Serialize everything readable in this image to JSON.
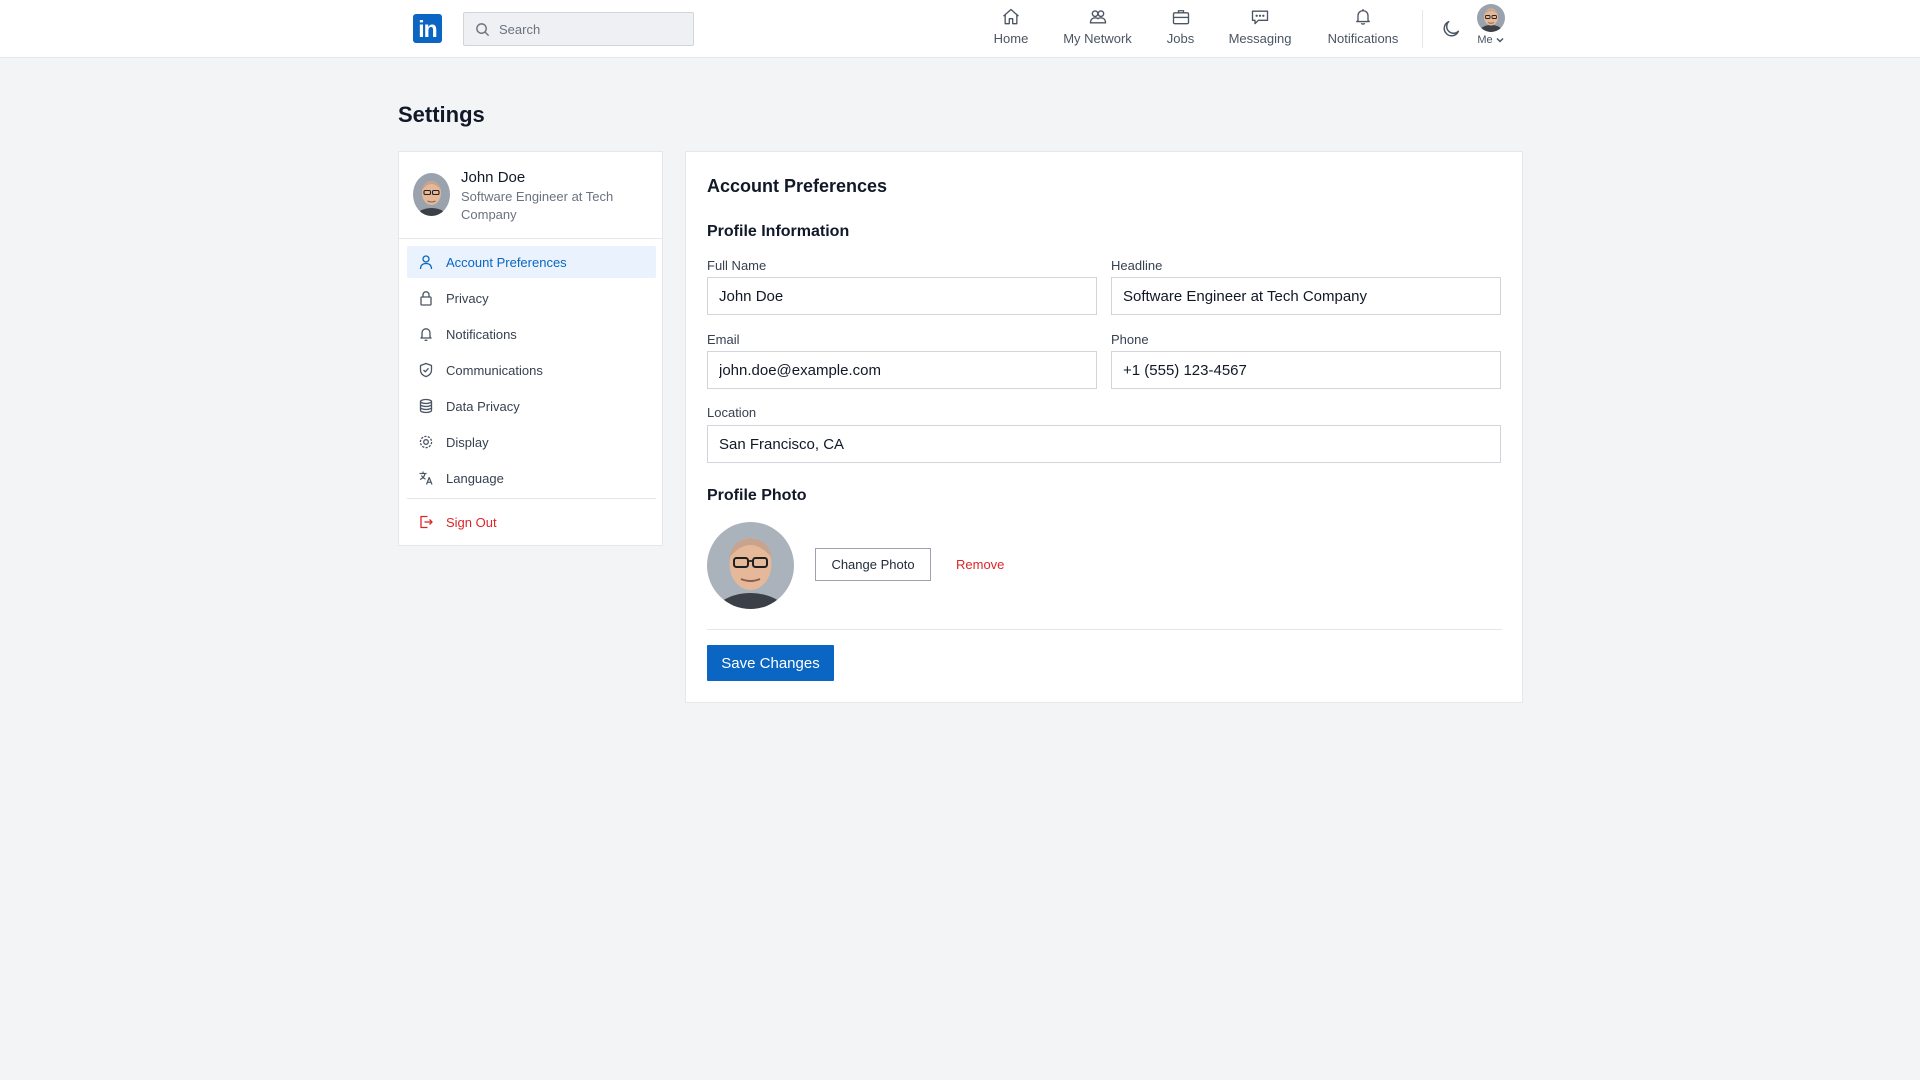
{
  "topbar": {
    "logo_text": "in",
    "search_placeholder": "Search",
    "nav": [
      {
        "label": "Home",
        "icon": "home-icon"
      },
      {
        "label": "My Network",
        "icon": "network-icon"
      },
      {
        "label": "Jobs",
        "icon": "briefcase-icon"
      },
      {
        "label": "Messaging",
        "icon": "chat-icon"
      },
      {
        "label": "Notifications",
        "icon": "bell-icon"
      }
    ],
    "me_label": "Me"
  },
  "page": {
    "title": "Settings"
  },
  "sidebar": {
    "profile": {
      "name": "John Doe",
      "headline": "Software Engineer at Tech Company"
    },
    "items": [
      {
        "label": "Account Preferences",
        "icon": "user-icon",
        "active": true
      },
      {
        "label": "Privacy",
        "icon": "lock-icon"
      },
      {
        "label": "Notifications",
        "icon": "bell-icon"
      },
      {
        "label": "Communications",
        "icon": "shield-icon"
      },
      {
        "label": "Data Privacy",
        "icon": "database-icon"
      },
      {
        "label": "Display",
        "icon": "gear-icon"
      },
      {
        "label": "Language",
        "icon": "translate-icon"
      }
    ],
    "signout_label": "Sign Out"
  },
  "main": {
    "title": "Account Preferences",
    "profile_section": "Profile Information",
    "fields": {
      "full_name": {
        "label": "Full Name",
        "value": "John Doe"
      },
      "headline": {
        "label": "Headline",
        "value": "Software Engineer at Tech Company"
      },
      "email": {
        "label": "Email",
        "value": "john.doe@example.com"
      },
      "phone": {
        "label": "Phone",
        "value": "+1 (555) 123-4567"
      },
      "location": {
        "label": "Location",
        "value": "San Francisco, CA"
      }
    },
    "photo_section": "Profile Photo",
    "change_photo_label": "Change Photo",
    "remove_label": "Remove",
    "save_label": "Save Changes"
  },
  "colors": {
    "brand": "#0a66c2",
    "danger": "#dc2626",
    "background": "#f3f4f6",
    "active_bg": "#eaf2fd"
  }
}
